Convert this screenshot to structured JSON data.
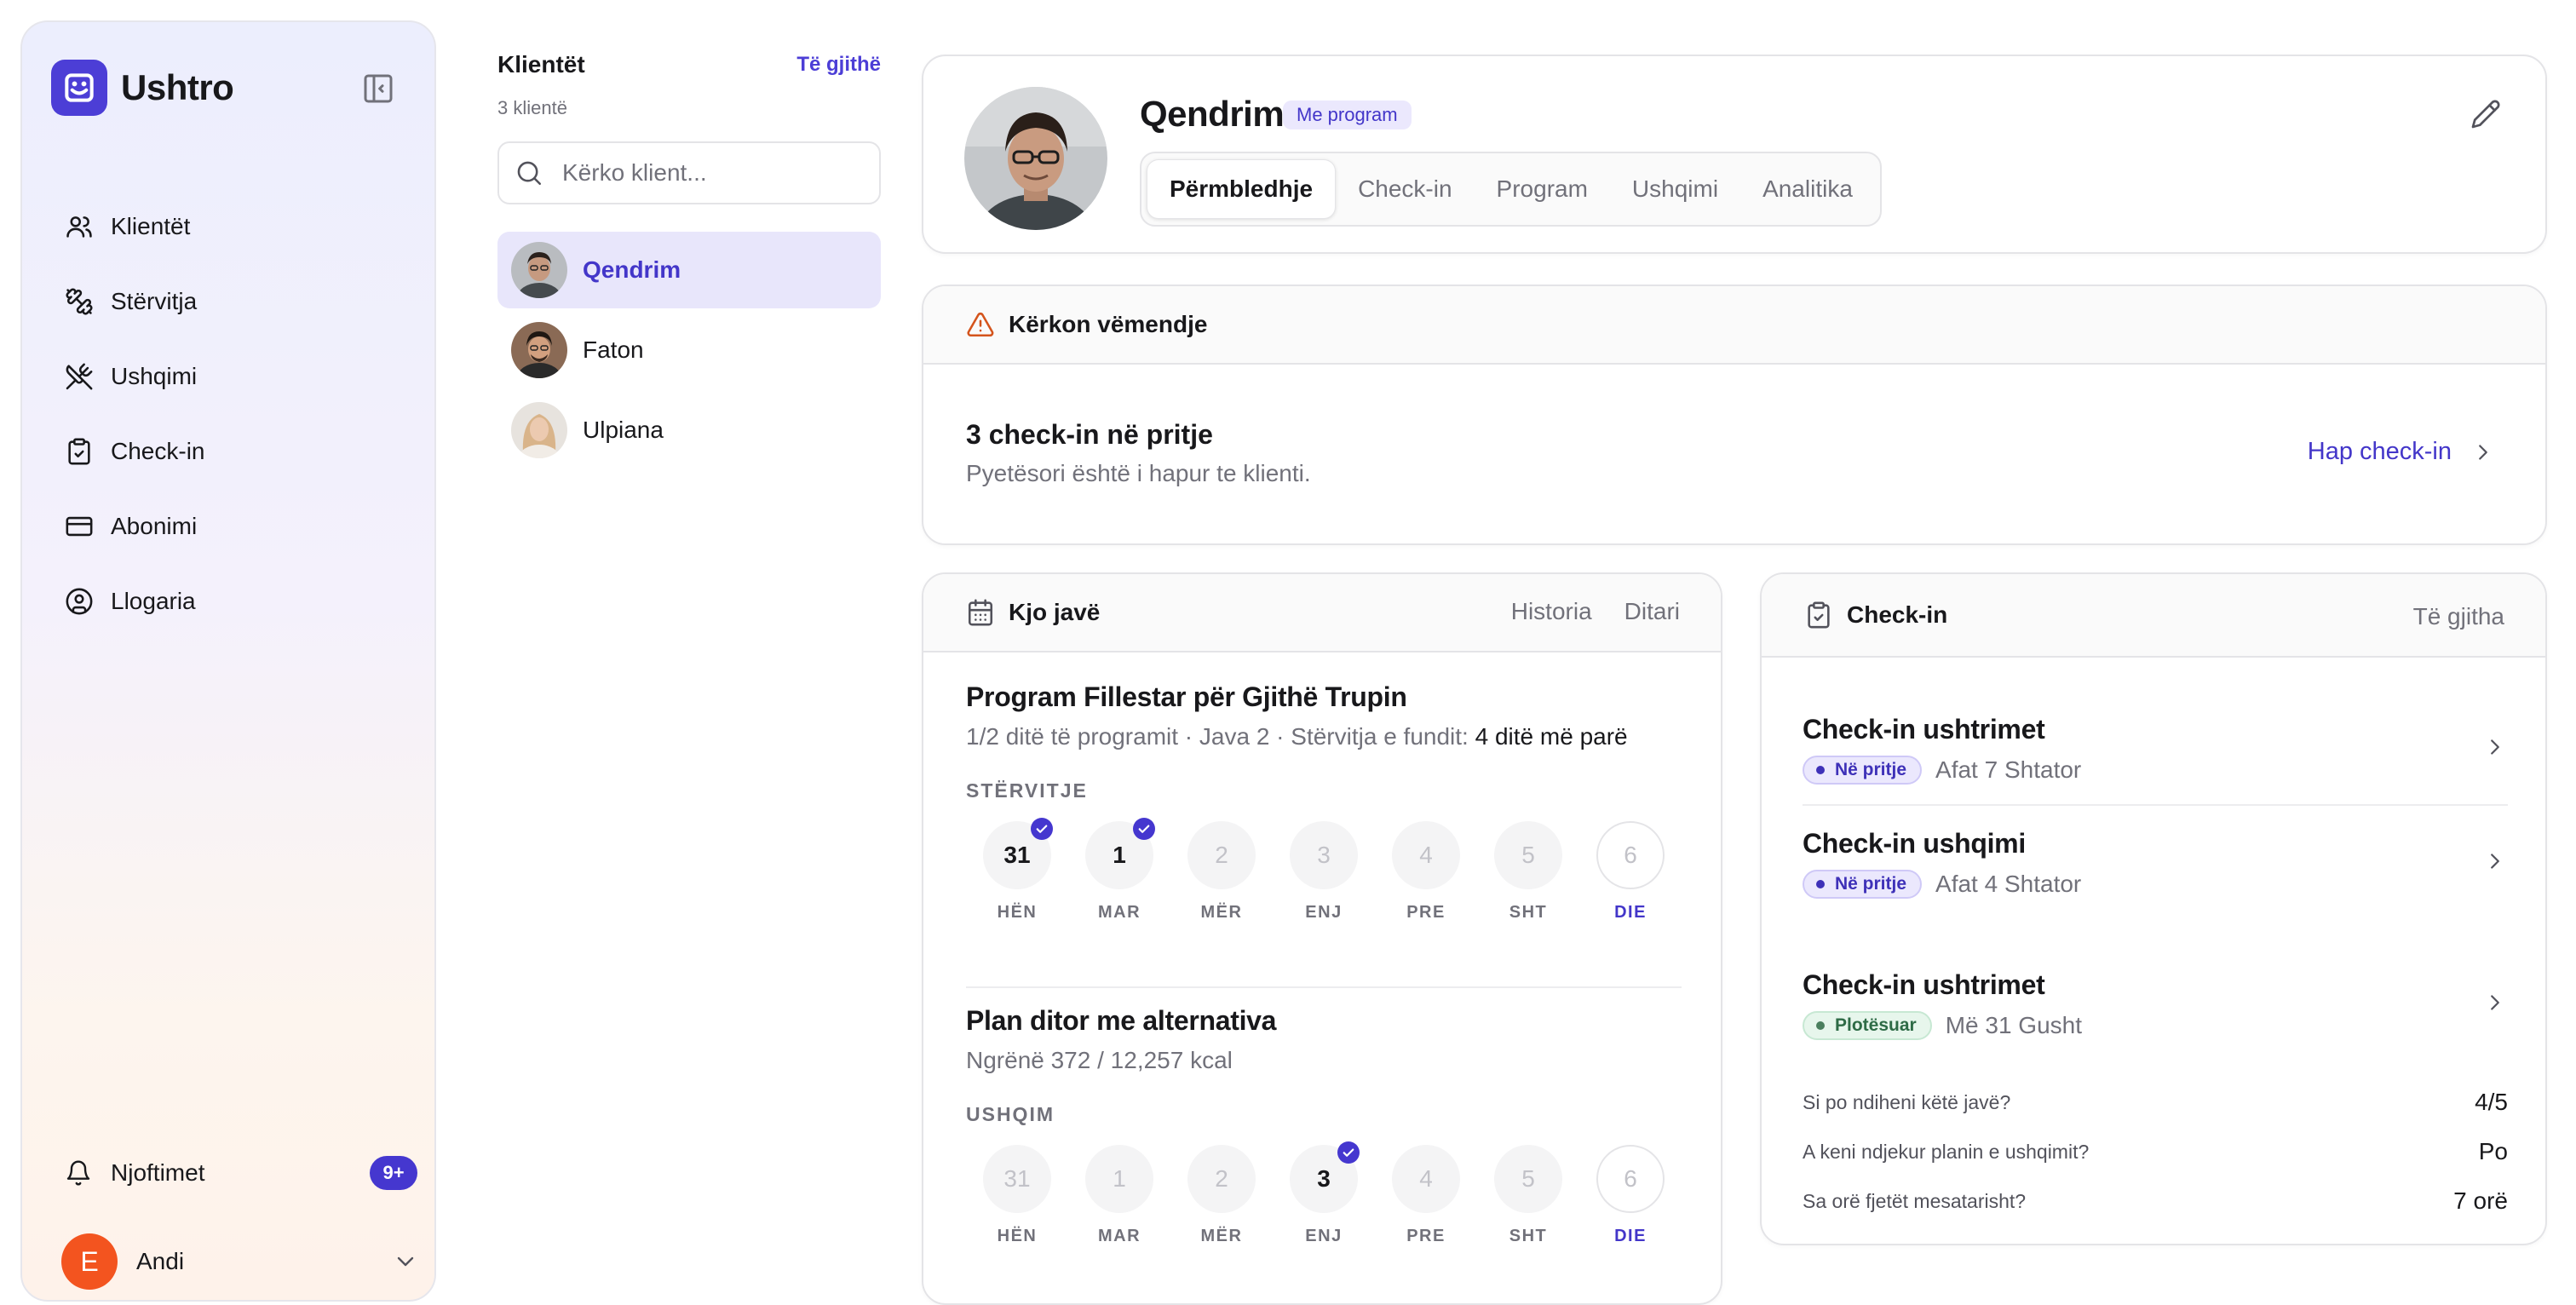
{
  "app": {
    "name": "Ushtro",
    "accent": "#4c3ed6"
  },
  "sidebar": {
    "items": [
      {
        "label": "Klientët",
        "icon": "users-icon"
      },
      {
        "label": "Stërvitja",
        "icon": "dumbbell-icon"
      },
      {
        "label": "Ushqimi",
        "icon": "utensils-icon"
      },
      {
        "label": "Check-in",
        "icon": "clipboard-check-icon"
      },
      {
        "label": "Abonimi",
        "icon": "credit-card-icon"
      },
      {
        "label": "Llogaria",
        "icon": "user-circle-icon"
      }
    ],
    "notifications": {
      "label": "Njoftimet",
      "badge": "9+"
    },
    "user": {
      "initial": "E",
      "name": "Andi"
    }
  },
  "clients": {
    "title": "Klientët",
    "see_all": "Të gjithë",
    "count": "3 klientë",
    "search_placeholder": "Kërko klient...",
    "list": [
      {
        "name": "Qendrim",
        "active": true
      },
      {
        "name": "Faton",
        "active": false
      },
      {
        "name": "Ulpiana",
        "active": false
      }
    ]
  },
  "profile": {
    "name": "Qendrim",
    "badge": "Me program",
    "tabs": [
      "Përmbledhje",
      "Check-in",
      "Program",
      "Ushqimi",
      "Analitika"
    ],
    "active_tab": 0
  },
  "attention": {
    "header": "Kërkon vëmendje",
    "title": "3 check-in në pritje",
    "subtitle": "Pyetësori është i hapur te klienti.",
    "link": "Hap check-in"
  },
  "week": {
    "header": "Kjo javë",
    "links": [
      "Historia",
      "Ditari"
    ],
    "training": {
      "title": "Program Fillestar për Gjithë Trupin",
      "subtitle_prefix": "1/2 ditë të programit · Java 2 · Stërvitja e fundit:",
      "subtitle_bold": "4 ditë më parë",
      "label": "STËRVITJE",
      "days": [
        {
          "num": "31",
          "label": "HËN",
          "done": true
        },
        {
          "num": "1",
          "label": "MAR",
          "done": true
        },
        {
          "num": "2",
          "label": "MËR",
          "done": false
        },
        {
          "num": "3",
          "label": "ENJ",
          "done": false
        },
        {
          "num": "4",
          "label": "PRE",
          "done": false
        },
        {
          "num": "5",
          "label": "SHT",
          "done": false
        },
        {
          "num": "6",
          "label": "DIE",
          "done": false,
          "today": true
        }
      ]
    },
    "nutrition": {
      "title": "Plan ditor me alternativa",
      "subtitle": "Ngrënë 372 / 12,257 kcal",
      "label": "USHQIM",
      "days": [
        {
          "num": "31",
          "label": "HËN",
          "done": false
        },
        {
          "num": "1",
          "label": "MAR",
          "done": false
        },
        {
          "num": "2",
          "label": "MËR",
          "done": false
        },
        {
          "num": "3",
          "label": "ENJ",
          "done": true
        },
        {
          "num": "4",
          "label": "PRE",
          "done": false
        },
        {
          "num": "5",
          "label": "SHT",
          "done": false
        },
        {
          "num": "6",
          "label": "DIE",
          "done": false,
          "today": true
        }
      ]
    }
  },
  "checkins": {
    "header": "Check-in",
    "see_all": "Të gjitha",
    "items": [
      {
        "title": "Check-in ushtrimet",
        "status": "Në pritje",
        "status_type": "pending",
        "meta": "Afat 7 Shtator"
      },
      {
        "title": "Check-in ushqimi",
        "status": "Në pritje",
        "status_type": "pending",
        "meta": "Afat 4 Shtator"
      },
      {
        "title": "Check-in ushtrimet",
        "status": "Plotësuar",
        "status_type": "done",
        "meta": "Më 31 Gusht"
      }
    ],
    "answers": [
      {
        "q": "Si po ndiheni këtë javë?",
        "a": "4/5"
      },
      {
        "q": "A keni ndjekur planin e ushqimit?",
        "a": "Po"
      },
      {
        "q": "Sa orë fjetët mesatarisht?",
        "a": "7 orë"
      }
    ]
  }
}
